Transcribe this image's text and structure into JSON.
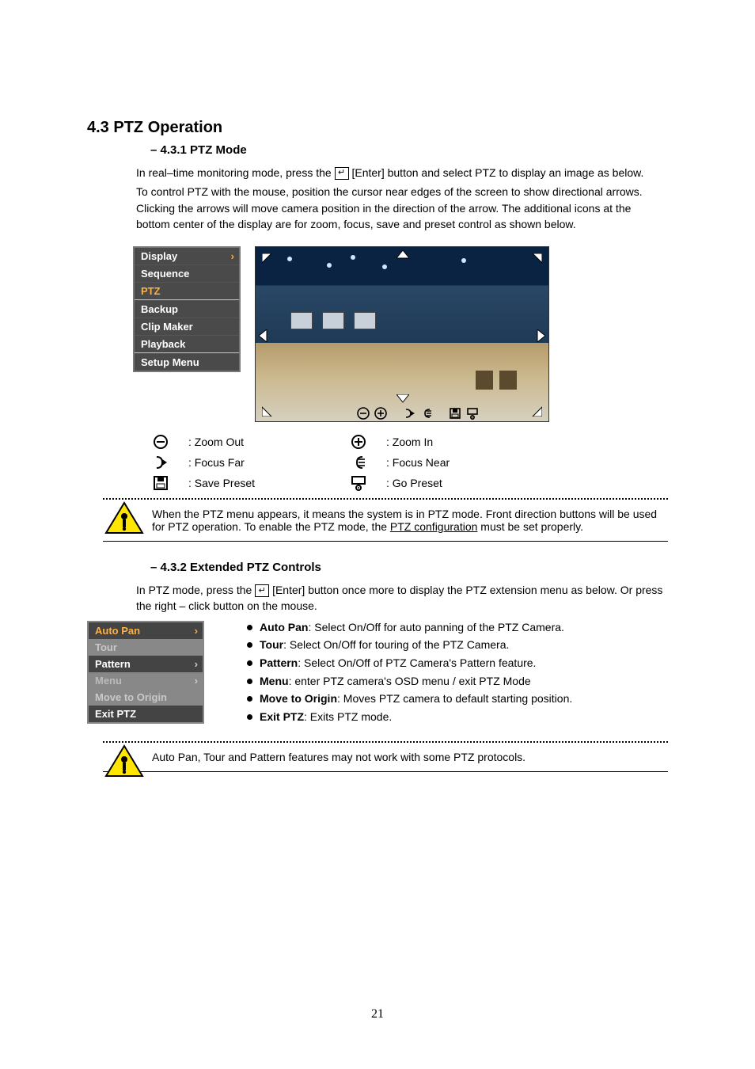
{
  "sections": {
    "ptz_operation": {
      "title": "4.3 PTZ Operation",
      "sub_heading": "4.3.1 PTZ Mode",
      "line1_pre": "In real–time monitoring mode, press the ",
      "line1_post": " button and select PTZ to display an image as below.",
      "line2": "To control PTZ with the mouse, position the cursor near edges of the screen to show directional arrows. Clicking the arrows will move camera position in the direction of the arrow. The additional icons at the bottom center of the display are for zoom, focus, save and preset control as shown below."
    },
    "context_menu": {
      "items": [
        {
          "label": "Display",
          "sel": false,
          "arrow": true
        },
        {
          "label": "Sequence",
          "sel": false,
          "arrow": false
        },
        {
          "label": "PTZ",
          "sel": true,
          "arrow": false
        },
        {
          "label": "Backup",
          "sel": false,
          "arrow": false
        },
        {
          "label": "Clip Maker",
          "sel": false,
          "arrow": false
        },
        {
          "label": "Playback",
          "sel": false,
          "arrow": false
        },
        {
          "label": "Setup Menu",
          "sel": false,
          "arrow": false
        }
      ],
      "divider_after": 2
    },
    "icon_legend": {
      "r1a": ": Zoom Out",
      "r1b": ": Zoom In",
      "r2a": ": Focus Far",
      "r2b": ": Focus Near",
      "r3a": ": Save Preset",
      "r3b": ": Go Preset"
    },
    "caution1": {
      "text_pre": "When the PTZ menu appears, it means the system is in PTZ mode. Front direction buttons will be used for PTZ operation. To enable the PTZ mode, the ",
      "link": "PTZ configuration",
      "text_post": " must be set properly."
    },
    "extended": {
      "title": "4.3.2 Extended PTZ Controls",
      "line_pre": "In PTZ mode, press the ",
      "line_post": " button once more to display the PTZ extension menu as below. Or press the right – click button on the mouse."
    },
    "ptz_ext_menu": {
      "items": [
        {
          "label": "Auto Pan",
          "cls": "sel",
          "arrow": true
        },
        {
          "label": "Tour",
          "cls": "lgrey",
          "arrow": false
        },
        {
          "label": "Pattern",
          "cls": "dark",
          "arrow": true
        },
        {
          "label": "Menu",
          "cls": "grey",
          "arrow": true
        },
        {
          "label": "Move to Origin",
          "cls": "lgrey",
          "arrow": false
        },
        {
          "label": "Exit PTZ",
          "cls": "dark",
          "arrow": false
        }
      ]
    },
    "bullets": [
      {
        "t": "Auto Pan",
        "d": ": Select On/Off for auto panning of the PTZ Camera."
      },
      {
        "t": "Tour",
        "d": ": Select On/Off for touring of the PTZ Camera."
      },
      {
        "t": "Pattern",
        "d": ": Select On/Off of PTZ Camera's Pattern feature."
      },
      {
        "t": "Menu",
        "d": ": enter PTZ camera's OSD menu / exit PTZ Mode"
      },
      {
        "t": "Move to Origin",
        "d": ": Moves PTZ camera to default starting position."
      },
      {
        "t": "Exit PTZ",
        "d": ": Exits PTZ mode."
      }
    ],
    "caution2": "Auto Pan, Tour and Pattern features may not work with some PTZ protocols.",
    "enter_label": "[Enter]",
    "page_number": "21"
  }
}
